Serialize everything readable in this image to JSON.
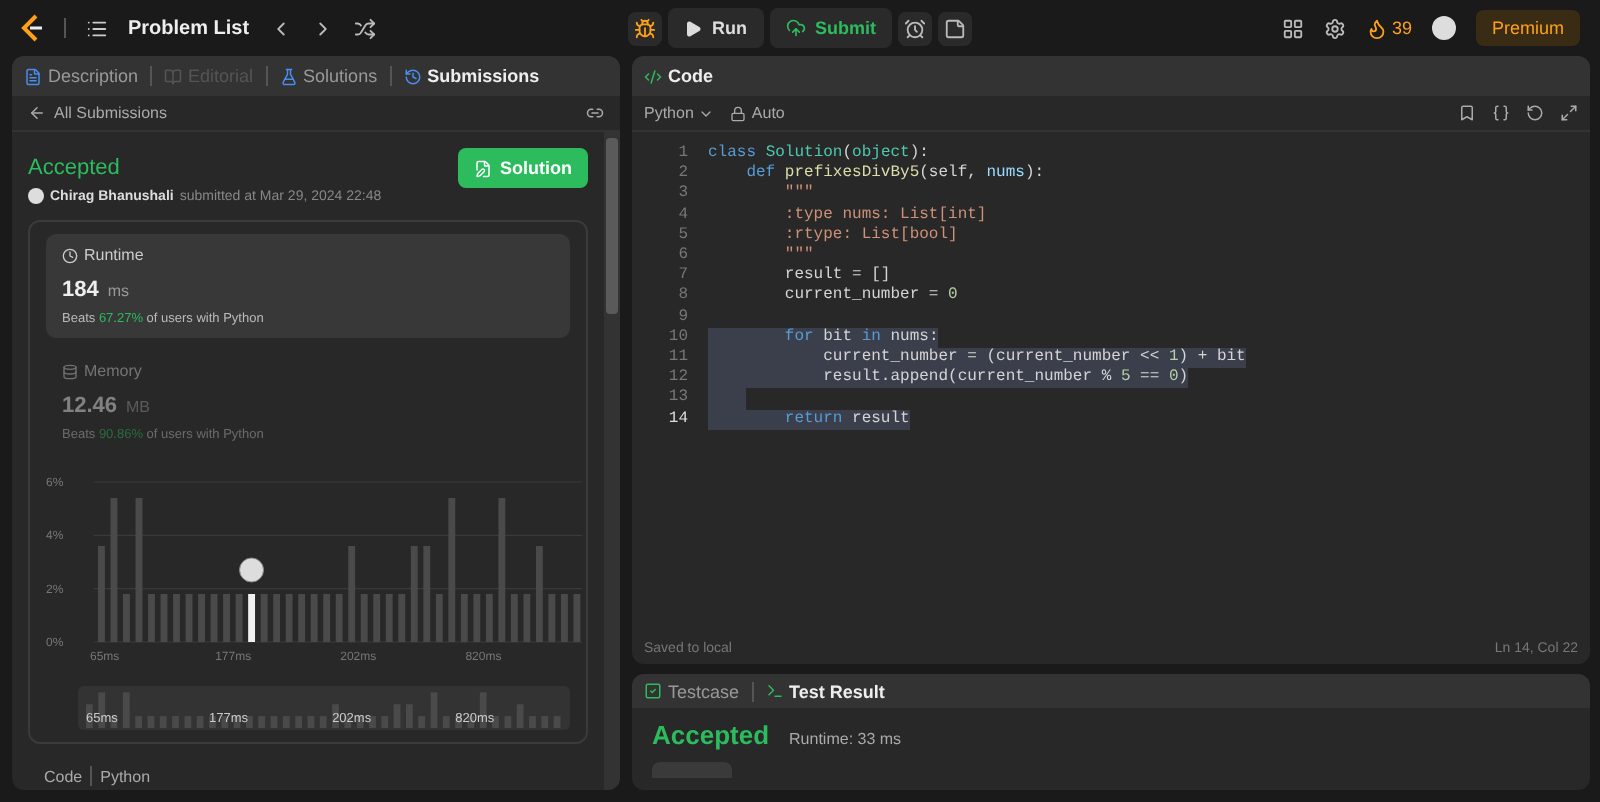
{
  "top_bar": {
    "problem_list": "Problem List",
    "run": "Run",
    "submit": "Submit",
    "streak": "39",
    "premium": "Premium"
  },
  "left_tabs": [
    {
      "label": "Description",
      "selected": false,
      "disabled": false
    },
    {
      "label": "Editorial",
      "selected": false,
      "disabled": true
    },
    {
      "label": "Solutions",
      "selected": false,
      "disabled": false
    },
    {
      "label": "Submissions",
      "selected": true,
      "disabled": false
    }
  ],
  "back_link": "All Submissions",
  "submission": {
    "status": "Accepted",
    "user": "Chirag Bhanushali",
    "submitted": "submitted at Mar 29, 2024 22:48",
    "solution_button": "Solution"
  },
  "metrics": [
    {
      "title": "Runtime",
      "value": "184",
      "unit": "ms",
      "beats": "Beats",
      "percent": "67.27%",
      "suffix": "of users with Python",
      "selected": true
    },
    {
      "title": "Memory",
      "value": "12.46",
      "unit": "MB",
      "beats": "Beats",
      "percent": "90.86%",
      "suffix": "of users with Python",
      "selected": false
    }
  ],
  "distribution": {
    "chart_data": {
      "type": "bar",
      "yticks": [
        {
          "value": 0,
          "label": "0%"
        },
        {
          "value": 2,
          "label": "2%"
        },
        {
          "value": 4,
          "label": "4%"
        },
        {
          "value": 6,
          "label": "6%"
        }
      ],
      "ylim": [
        0,
        6
      ],
      "categories": [
        "65ms",
        null,
        null,
        null,
        null,
        null,
        null,
        null,
        null,
        null,
        "177ms",
        null,
        null,
        null,
        null,
        null,
        null,
        null,
        null,
        null,
        "202ms",
        null,
        null,
        null,
        null,
        null,
        null,
        null,
        null,
        null,
        "820ms",
        null,
        null,
        null,
        null,
        null,
        null,
        null,
        null
      ],
      "stacked": true,
      "series": [
        {
          "color": "#4a4a4a",
          "values": [
            3.6,
            5.4,
            1.8,
            5.4,
            1.8,
            1.8,
            1.8,
            1.8,
            1.8,
            1.8,
            1.8,
            1.8,
            null,
            1.8,
            1.8,
            1.8,
            1.8,
            1.8,
            1.8,
            1.8,
            3.6,
            1.8,
            1.8,
            1.8,
            1.8,
            3.6,
            3.6,
            1.8,
            5.4,
            1.8,
            1.8,
            1.8,
            5.4,
            1.8,
            1.8,
            3.6,
            1.8,
            1.8,
            1.8
          ]
        },
        {
          "color": "#f0f0f0",
          "values": [
            null,
            null,
            null,
            null,
            null,
            null,
            null,
            null,
            null,
            null,
            null,
            null,
            1.8,
            null,
            null,
            null,
            null,
            null,
            null,
            null,
            null,
            null,
            null,
            null,
            null,
            null,
            null,
            null,
            null,
            null,
            null,
            null,
            null,
            null,
            null,
            null,
            null,
            null,
            null
          ]
        }
      ]
    },
    "overview_labels": [
      "65ms",
      "177ms",
      "202ms",
      "820ms"
    ]
  },
  "code_footer": {
    "label": "Code",
    "language": "Python"
  },
  "editor": {
    "tab": "Code",
    "language": "Python",
    "mode": "Auto",
    "lines": [
      {
        "number": "1",
        "selected": false,
        "tokens": [
          {
            "kind": "kw",
            "text": "class"
          },
          {
            "kind": "cls",
            "text": " Solution"
          },
          {
            "kind": "plain",
            "text": "("
          },
          {
            "kind": "cls",
            "text": "object"
          },
          {
            "kind": "plain",
            "text": "):"
          }
        ]
      },
      {
        "number": "2",
        "selected": false,
        "tokens": [
          {
            "kind": "kw",
            "text": "    def"
          },
          {
            "kind": "fn",
            "text": " prefixesDivBy5"
          },
          {
            "kind": "plain",
            "text": "(self, "
          },
          {
            "kind": "param",
            "text": "nums"
          },
          {
            "kind": "plain",
            "text": "):"
          }
        ]
      },
      {
        "number": "3",
        "selected": false,
        "tokens": [
          {
            "kind": "str",
            "text": "        \"\"\""
          }
        ]
      },
      {
        "number": "4",
        "selected": false,
        "tokens": [
          {
            "kind": "str",
            "text": "        :type nums: List[int]"
          }
        ]
      },
      {
        "number": "5",
        "selected": false,
        "tokens": [
          {
            "kind": "str",
            "text": "        :rtype: List[bool]"
          }
        ]
      },
      {
        "number": "6",
        "selected": false,
        "tokens": [
          {
            "kind": "str",
            "text": "        \"\"\""
          }
        ]
      },
      {
        "number": "7",
        "selected": false,
        "tokens": [
          {
            "kind": "plain",
            "text": "        result = []"
          }
        ]
      },
      {
        "number": "8",
        "selected": false,
        "tokens": [
          {
            "kind": "plain",
            "text": "        current_number = "
          },
          {
            "kind": "num",
            "text": "0"
          }
        ]
      },
      {
        "number": "9",
        "selected": false
      },
      {
        "number": "10",
        "selected": true,
        "tokens": [
          {
            "kind": "kw",
            "text": "        for"
          },
          {
            "kind": "plain",
            "text": " bit "
          },
          {
            "kind": "kw",
            "text": "in"
          },
          {
            "kind": "plain",
            "text": " nums:"
          }
        ]
      },
      {
        "number": "11",
        "selected": true,
        "tokens": [
          {
            "kind": "plain",
            "text": "            current_number = (current_number << "
          },
          {
            "kind": "num",
            "text": "1"
          },
          {
            "kind": "plain",
            "text": ") + bit"
          }
        ]
      },
      {
        "number": "12",
        "selected": true,
        "tokens": [
          {
            "kind": "plain",
            "text": "            result.append(current_number % "
          },
          {
            "kind": "num",
            "text": "5"
          },
          {
            "kind": "plain",
            "text": " == "
          },
          {
            "kind": "num",
            "text": "0"
          },
          {
            "kind": "plain",
            "text": ")"
          }
        ]
      },
      {
        "number": "13",
        "selected": true
      },
      {
        "number": "14",
        "selected": true,
        "tokens": [
          {
            "kind": "kw",
            "text": "        return"
          },
          {
            "kind": "plain",
            "text": " result"
          }
        ]
      }
    ],
    "status": "Saved to local",
    "cursor": "Ln 14, Col 22"
  },
  "result_tabs": [
    {
      "label": "Testcase",
      "selected": false
    },
    {
      "label": "Test Result",
      "selected": true
    }
  ],
  "result": {
    "status": "Accepted",
    "runtime": "Runtime: 33 ms"
  }
}
